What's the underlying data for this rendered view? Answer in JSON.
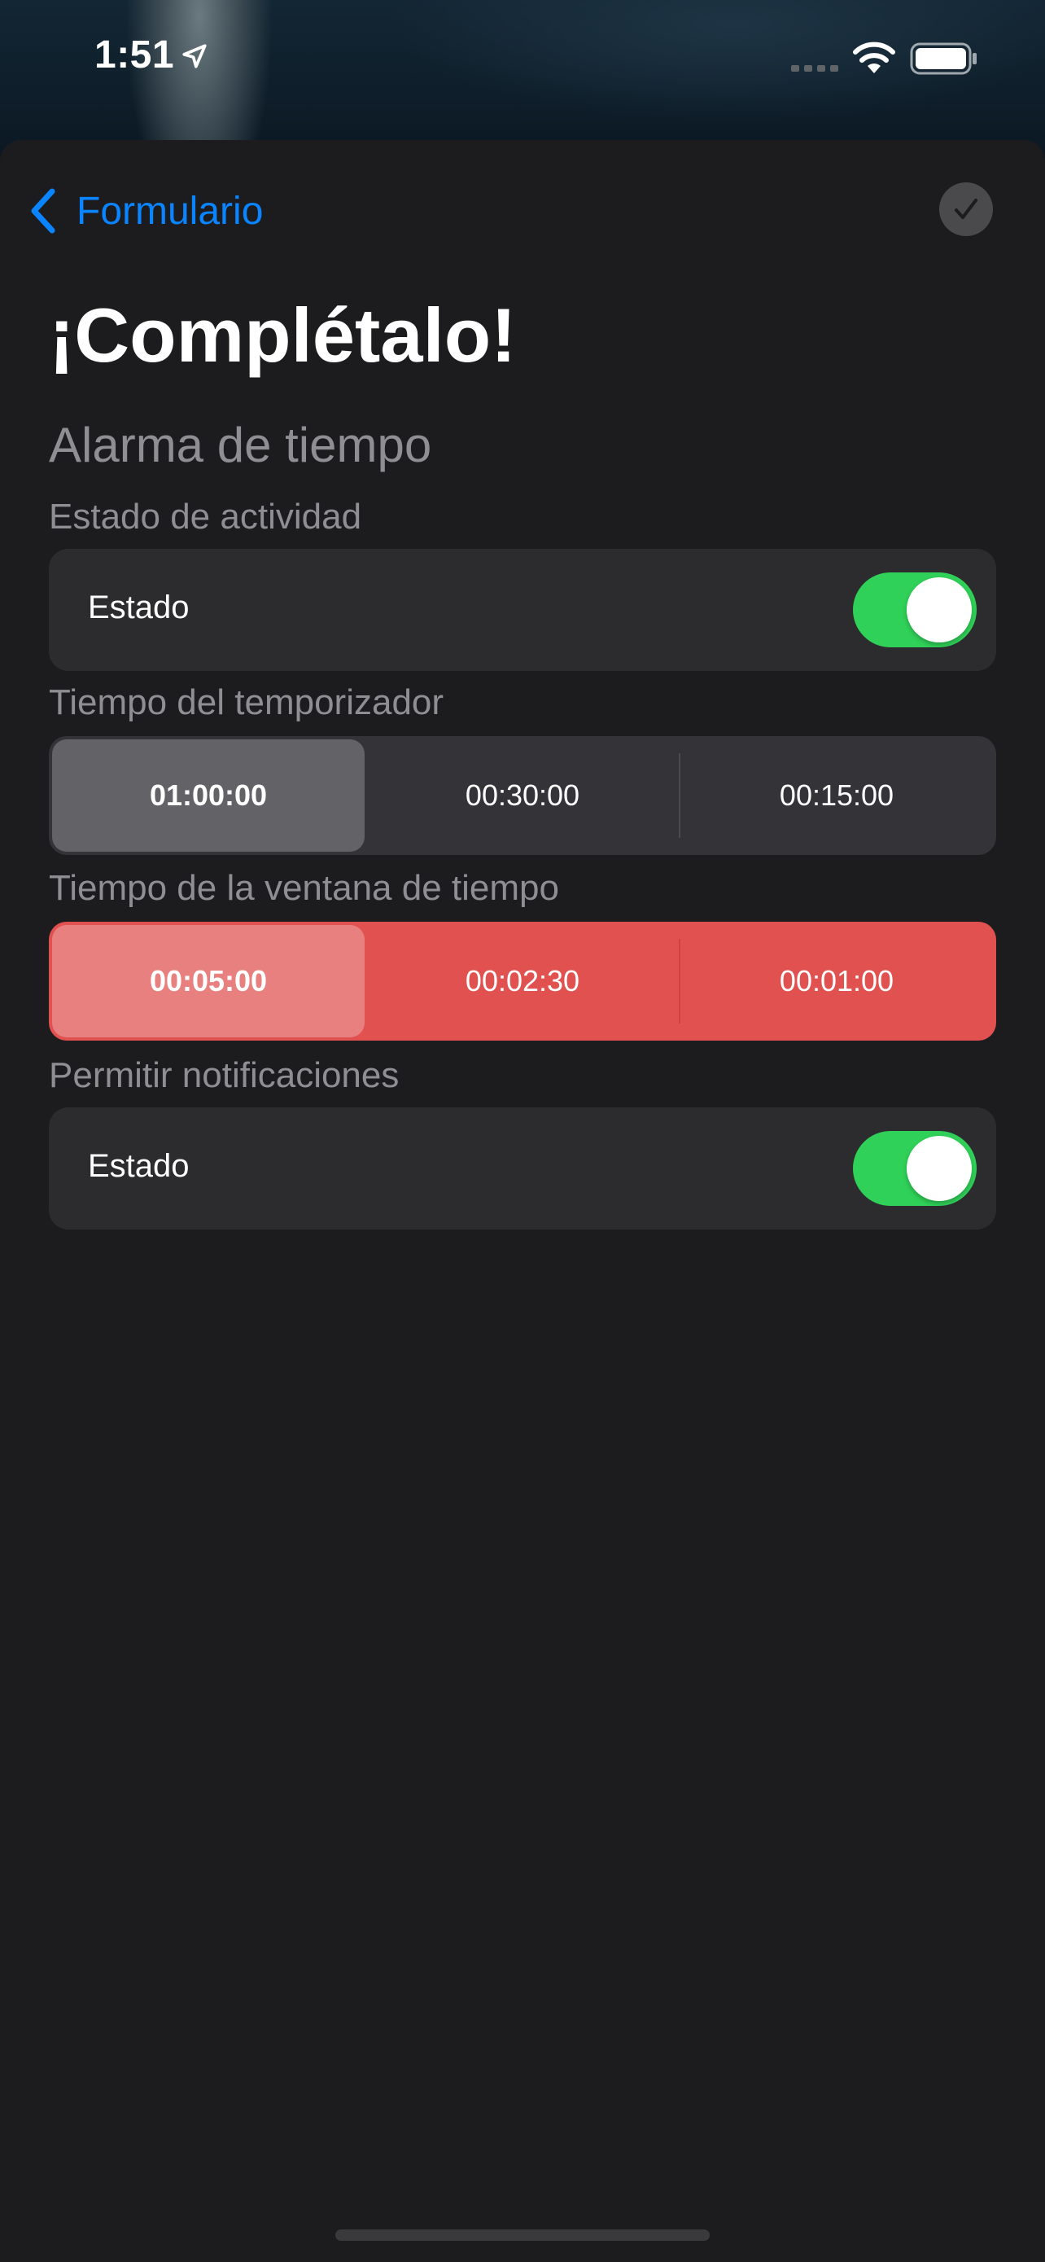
{
  "status_bar": {
    "time": "1:51",
    "icons": [
      "location-arrow-icon",
      "cellular-signal-icon",
      "wifi-icon",
      "battery-icon"
    ]
  },
  "nav": {
    "back_label": "Formulario",
    "back_icon": "chevron-left-icon",
    "done_icon": "checkmark-icon"
  },
  "page": {
    "title": "¡Complétalo!",
    "section_title": "Alarma de tiempo"
  },
  "activity": {
    "group_label": "Estado de actividad",
    "cell_label": "Estado",
    "toggle_on": true
  },
  "timer": {
    "group_label": "Tiempo del temporizador",
    "options": [
      "01:00:00",
      "00:30:00",
      "00:15:00"
    ],
    "selected": "01:00:00"
  },
  "window": {
    "group_label": "Tiempo de la ventana de tiempo",
    "options": [
      "00:05:00",
      "00:02:30",
      "00:01:00"
    ],
    "selected": "00:05:00"
  },
  "notifications": {
    "group_label": "Permitir notificaciones",
    "cell_label": "Estado",
    "toggle_on": true
  },
  "colors": {
    "accent_blue": "#0a84ff",
    "toggle_green": "#30d158",
    "window_red": "#e05150",
    "background": "#1c1c1e",
    "cell": "#2c2c2e"
  }
}
